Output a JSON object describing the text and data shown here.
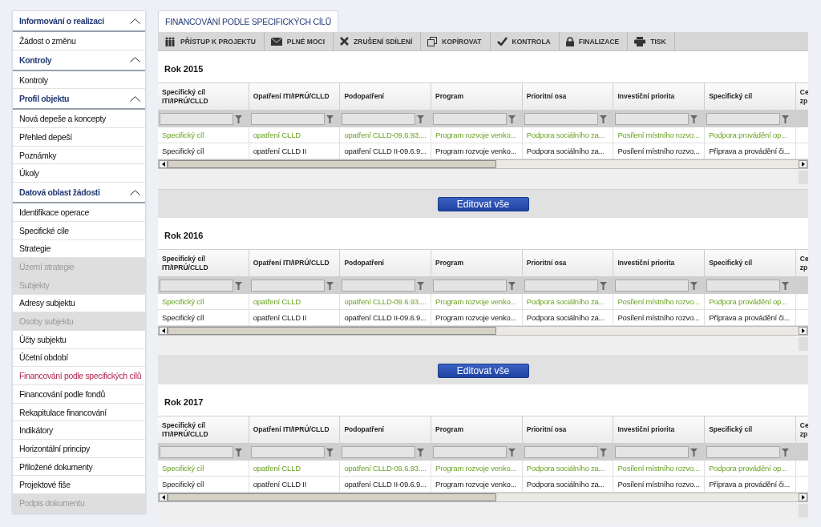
{
  "sidebar": {
    "items": [
      {
        "kind": "header",
        "label": "Informování o realizaci",
        "expanded": true,
        "selected": false
      },
      {
        "kind": "item",
        "label": "Žádost o změnu",
        "disabled": false,
        "selected": false
      },
      {
        "kind": "header",
        "label": "Kontroly",
        "expanded": true,
        "selected": false
      },
      {
        "kind": "item",
        "label": "Kontroly",
        "disabled": false,
        "selected": false
      },
      {
        "kind": "header",
        "label": "Profil objektu",
        "expanded": true,
        "selected": false
      },
      {
        "kind": "item",
        "label": "Nová depeše a koncepty",
        "disabled": false,
        "selected": false
      },
      {
        "kind": "item",
        "label": "Přehled depeší",
        "disabled": false,
        "selected": false
      },
      {
        "kind": "item",
        "label": "Poznámky",
        "disabled": false,
        "selected": false
      },
      {
        "kind": "item",
        "label": "Úkoly",
        "disabled": false,
        "selected": false
      },
      {
        "kind": "header",
        "label": "Datová oblast žádosti",
        "expanded": true,
        "selected": false
      },
      {
        "kind": "item",
        "label": "Identifikace operace",
        "disabled": false,
        "selected": false
      },
      {
        "kind": "item",
        "label": "Specifické cíle",
        "disabled": false,
        "selected": false
      },
      {
        "kind": "item",
        "label": "Strategie",
        "disabled": false,
        "selected": false
      },
      {
        "kind": "item",
        "label": "Území strategie",
        "disabled": true,
        "selected": false
      },
      {
        "kind": "item",
        "label": "Subjekty",
        "disabled": true,
        "selected": false
      },
      {
        "kind": "item",
        "label": "Adresy subjektu",
        "disabled": false,
        "selected": false
      },
      {
        "kind": "item",
        "label": "Osoby subjektu",
        "disabled": true,
        "selected": false
      },
      {
        "kind": "item",
        "label": "Účty subjektu",
        "disabled": false,
        "selected": false
      },
      {
        "kind": "item",
        "label": "Účetní období",
        "disabled": false,
        "selected": false
      },
      {
        "kind": "item",
        "label": "Financování podle specifických cílů",
        "disabled": false,
        "selected": true
      },
      {
        "kind": "item",
        "label": "Financování podle fondů",
        "disabled": false,
        "selected": false
      },
      {
        "kind": "item",
        "label": "Rekapitulace financování",
        "disabled": false,
        "selected": false
      },
      {
        "kind": "item",
        "label": "Indikátory",
        "disabled": false,
        "selected": false
      },
      {
        "kind": "item",
        "label": "Horizontální principy",
        "disabled": false,
        "selected": false
      },
      {
        "kind": "item",
        "label": "Přiložené dokumenty",
        "disabled": false,
        "selected": false
      },
      {
        "kind": "item",
        "label": "Projektové fiše",
        "disabled": false,
        "selected": false
      },
      {
        "kind": "item",
        "label": "Podpis dokumentu",
        "disabled": true,
        "selected": false
      }
    ]
  },
  "tab": {
    "label": "FINANCOVÁNÍ PODLE SPECIFICKÝCH CÍLŮ",
    "selected": true
  },
  "toolbar": [
    {
      "kind": "people",
      "label": "PŘÍSTUP K PROJEKTU"
    },
    {
      "kind": "mail",
      "label": "PLNÉ MOCI"
    },
    {
      "kind": "cross",
      "label": "ZRUŠENÍ SDÍLENÍ"
    },
    {
      "kind": "copy",
      "label": "KOPÍROVAT"
    },
    {
      "kind": "check",
      "label": "KONTROLA"
    },
    {
      "kind": "lock",
      "label": "FINALIZACE"
    },
    {
      "kind": "print",
      "label": "TISK"
    }
  ],
  "sections": [
    {
      "title": "Rok 2015",
      "columns": [
        "Specifický cíl ITI/IPRÚ/CLLD",
        "Opatření ITI/IPRÚ/CLLD",
        "Podopatření",
        "Program",
        "Prioritní osa",
        "Investiční priorita",
        "Specifický cíl",
        "Ce zp"
      ],
      "rows": [
        {
          "highlighted": true,
          "cells": [
            "Specifický cíl",
            "opatření CLLD",
            "opatření CLLD-09.6.93....",
            "Program rozvoje venko...",
            "Podpora sociálního za...",
            "Posílení místního rozvo...",
            "Podpora provádění op..."
          ]
        },
        {
          "highlighted": false,
          "cells": [
            "Specifický cíl",
            "opatření CLLD II",
            "opatření CLLD II-09.6.9...",
            "Program rozvoje venko...",
            "Podpora sociálního za...",
            "Posílení místního rozvo...",
            "Příprava a provádění či..."
          ]
        }
      ],
      "button": "Editovat vše"
    },
    {
      "title": "Rok 2016",
      "columns": [
        "Specifický cíl ITI/IPRÚ/CLLD",
        "Opatření ITI/IPRÚ/CLLD",
        "Podopatření",
        "Program",
        "Prioritní osa",
        "Investiční priorita",
        "Specifický cíl",
        "Ce zp"
      ],
      "rows": [
        {
          "highlighted": true,
          "cells": [
            "Specifický cíl",
            "opatření CLLD",
            "opatření CLLD-09.6.93....",
            "Program rozvoje venko...",
            "Podpora sociálního za...",
            "Posílení místního rozvo...",
            "Podpora provádění op..."
          ]
        },
        {
          "highlighted": false,
          "cells": [
            "Specifický cíl",
            "opatření CLLD II",
            "opatření CLLD II-09.6.9...",
            "Program rozvoje venko...",
            "Podpora sociálního za...",
            "Posílení místního rozvo...",
            "Příprava a provádění či..."
          ]
        }
      ],
      "button": "Editovat vše"
    },
    {
      "title": "Rok 2017",
      "columns": [
        "Specifický cíl ITI/IPRÚ/CLLD",
        "Opatření ITI/IPRÚ/CLLD",
        "Podopatření",
        "Program",
        "Prioritní osa",
        "Investiční priorita",
        "Specifický cíl",
        "Ce zp"
      ],
      "rows": [
        {
          "highlighted": true,
          "cells": [
            "Specifický cíl",
            "opatření CLLD",
            "opatření CLLD-09.6.93....",
            "Program rozvoje venko...",
            "Podpora sociálního za...",
            "Posílení místního rozvo...",
            "Podpora provádění op..."
          ]
        },
        {
          "highlighted": false,
          "cells": [
            "Specifický cíl",
            "opatření CLLD II",
            "opatření CLLD II-09.6.9...",
            "Program rozvoje venko...",
            "Podpora sociálního za...",
            "Posílení místního rozvo...",
            "Příprava a provádění či..."
          ]
        }
      ]
    }
  ]
}
